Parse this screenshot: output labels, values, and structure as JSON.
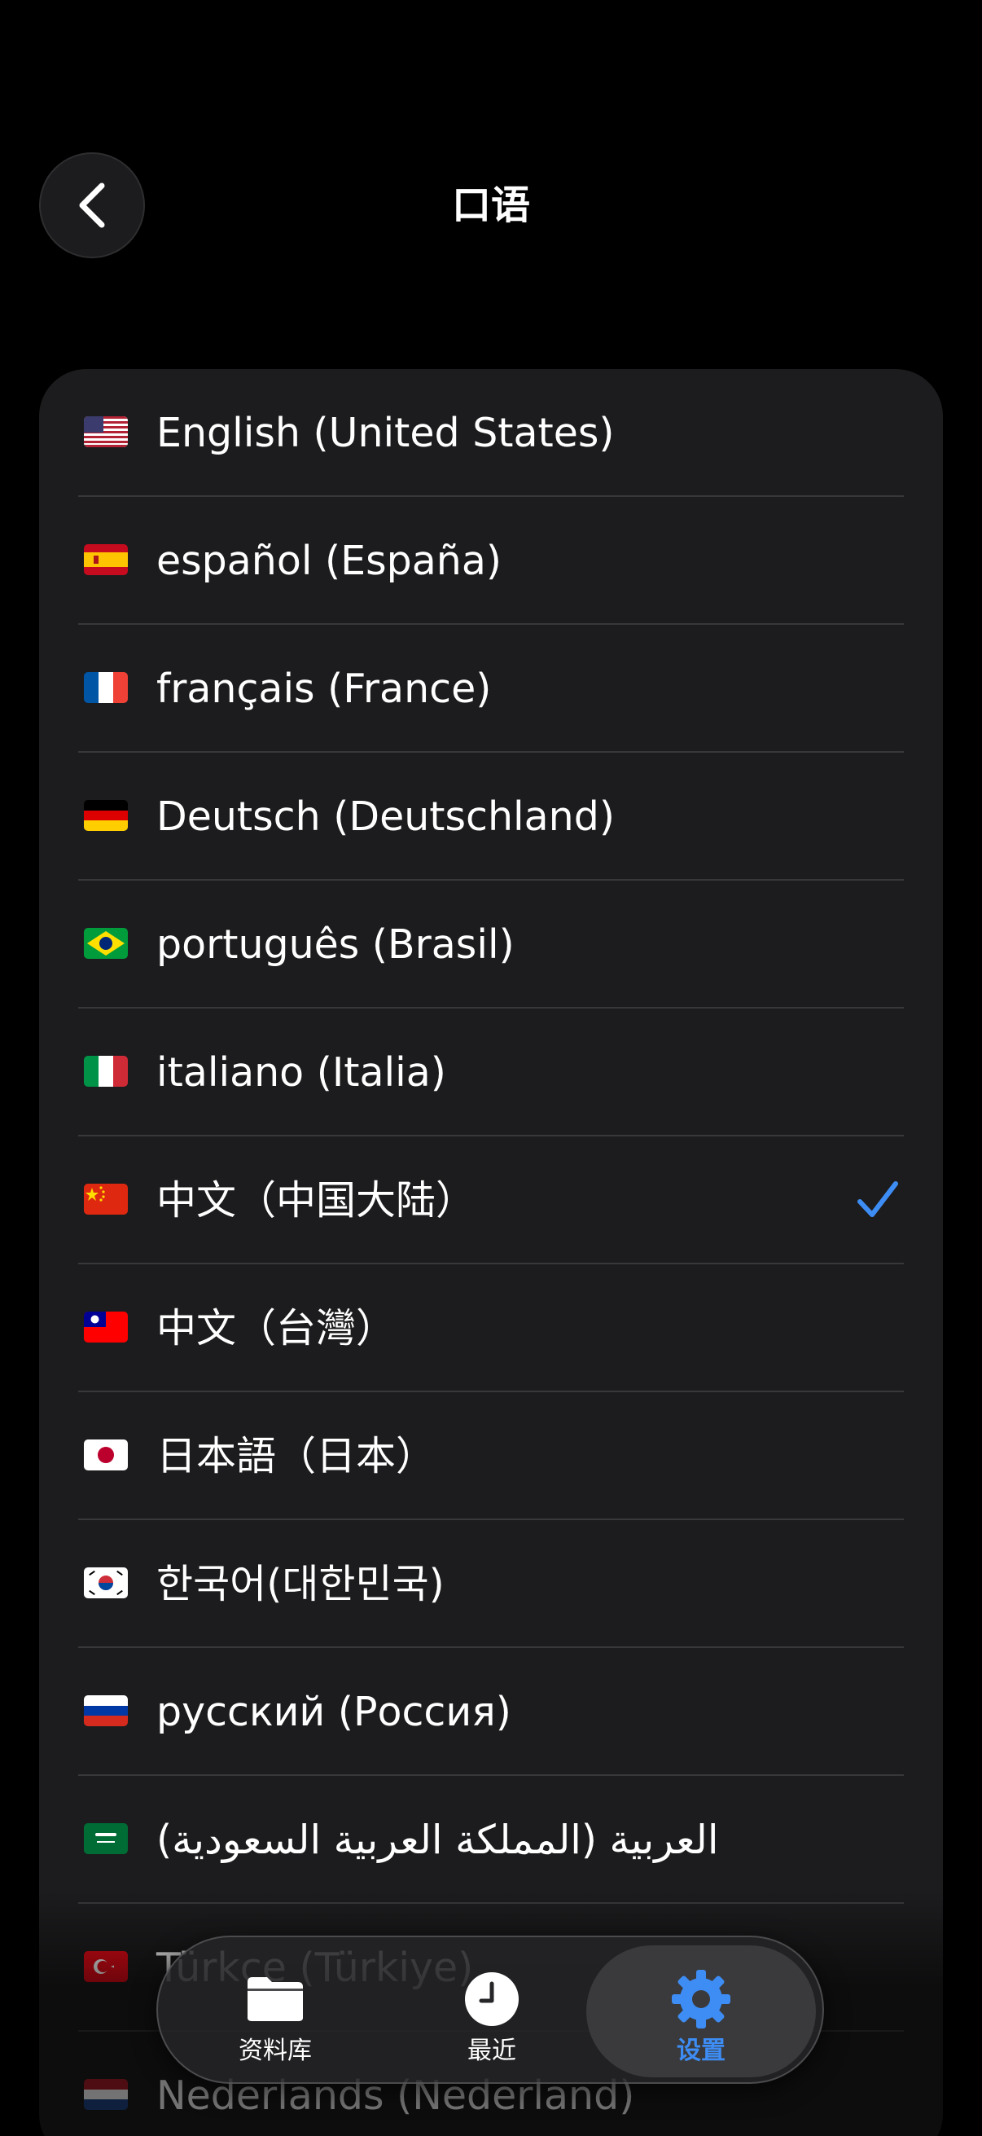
{
  "header": {
    "title": "口语",
    "back_icon": "chevron-left-icon"
  },
  "languages": [
    {
      "label": "English (United States)",
      "flag": "us-flag-icon",
      "selected": false
    },
    {
      "label": "español (España)",
      "flag": "es-flag-icon",
      "selected": false
    },
    {
      "label": "français (France)",
      "flag": "fr-flag-icon",
      "selected": false
    },
    {
      "label": "Deutsch (Deutschland)",
      "flag": "de-flag-icon",
      "selected": false
    },
    {
      "label": "português (Brasil)",
      "flag": "br-flag-icon",
      "selected": false
    },
    {
      "label": "italiano (Italia)",
      "flag": "it-flag-icon",
      "selected": false
    },
    {
      "label": "中文（中国大陆）",
      "flag": "cn-flag-icon",
      "selected": true
    },
    {
      "label": "中文（台灣）",
      "flag": "tw-flag-icon",
      "selected": false
    },
    {
      "label": "日本語（日本）",
      "flag": "jp-flag-icon",
      "selected": false
    },
    {
      "label": "한국어(대한민국)",
      "flag": "kr-flag-icon",
      "selected": false
    },
    {
      "label": "русский (Россия)",
      "flag": "ru-flag-icon",
      "selected": false
    },
    {
      "label": "العربية (المملكة العربية السعودية)",
      "flag": "sa-flag-icon",
      "selected": false
    },
    {
      "label": "Türkçe (Türkiye)",
      "flag": "tr-flag-icon",
      "selected": false
    },
    {
      "label": "Nederlands (Nederland)",
      "flag": "nl-flag-icon",
      "selected": false
    }
  ],
  "tabbar": {
    "tabs": [
      {
        "label": "资料库",
        "icon": "folder-icon",
        "active": false
      },
      {
        "label": "最近",
        "icon": "clock-icon",
        "active": false
      },
      {
        "label": "设置",
        "icon": "gear-icon",
        "active": true
      }
    ]
  },
  "colors": {
    "background": "#000000",
    "card": "#1c1c1e",
    "separator": "#38383a",
    "accent": "#3d8df5"
  }
}
